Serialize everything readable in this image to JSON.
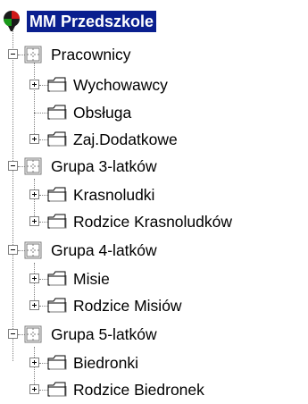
{
  "tree": {
    "root": {
      "label": "MM Przedszkole",
      "icon": "balloon-icon",
      "selected": true
    },
    "groups": [
      {
        "label": "Pracownicy",
        "icon": "group-icon",
        "expanded": true,
        "children": [
          {
            "label": "Wychowawcy",
            "icon": "folder-icon",
            "expandable": true
          },
          {
            "label": "Obsługa",
            "icon": "folder-icon",
            "expandable": false
          },
          {
            "label": "Zaj.Dodatkowe",
            "icon": "folder-icon",
            "expandable": true
          }
        ]
      },
      {
        "label": "Grupa 3-latków",
        "icon": "group-icon",
        "expanded": true,
        "children": [
          {
            "label": "Krasnoludki",
            "icon": "folder-icon",
            "expandable": true
          },
          {
            "label": "Rodzice Krasnoludków",
            "icon": "folder-icon",
            "expandable": true
          }
        ]
      },
      {
        "label": "Grupa 4-latków",
        "icon": "group-icon",
        "expanded": true,
        "children": [
          {
            "label": "Misie",
            "icon": "folder-icon",
            "expandable": true
          },
          {
            "label": "Rodzice Misiów",
            "icon": "folder-icon",
            "expandable": true
          }
        ]
      },
      {
        "label": "Grupa 5-latków",
        "icon": "group-icon",
        "expanded": true,
        "children": [
          {
            "label": "Biedronki",
            "icon": "folder-icon",
            "expandable": true
          },
          {
            "label": "Rodzice Biedronek",
            "icon": "folder-icon",
            "expandable": true
          }
        ]
      }
    ]
  },
  "colors": {
    "selection": "#0a1f8f",
    "group_icon": "#7a7a7a",
    "balloon_red": "#d01818",
    "balloon_green": "#1a9a1a"
  }
}
